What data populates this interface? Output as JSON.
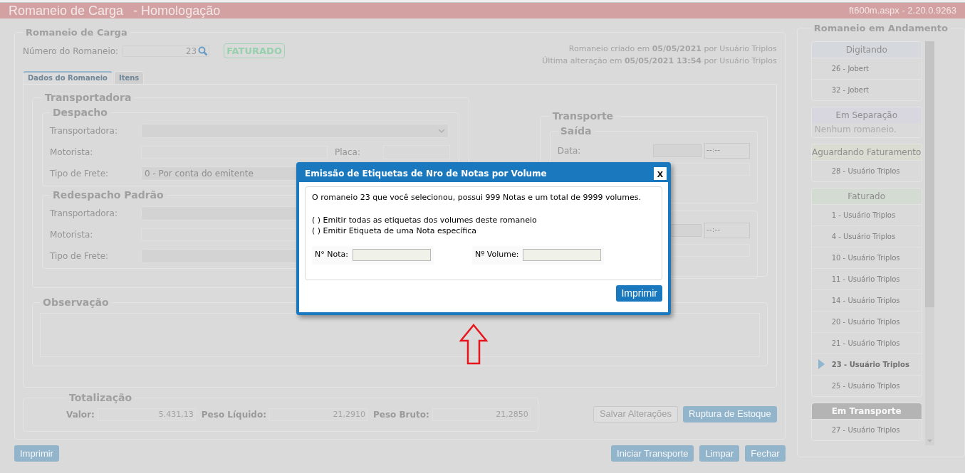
{
  "header": {
    "title": "Romaneio de Carga",
    "environment": "- Homologação",
    "version": "ft600m.aspx - 2.20.0.9263"
  },
  "romaneio": {
    "legend": "Romaneio de Carga",
    "number_label": "Número do Romaneio:",
    "number": "23",
    "status": "FATURADO",
    "created": "Romaneio criado em **05/05/2021** por Usuário Triplos",
    "updated": "Última alteração em **05/05/2021 13:54** por Usuário Triplos"
  },
  "tabs": [
    {
      "label": "Dados do Romaneio",
      "selected": true
    },
    {
      "label": "Itens",
      "selected": false
    }
  ],
  "transportadora": {
    "legend": "Transportadora",
    "sections": [
      {
        "legend": "Despacho",
        "fields": [
          {
            "kind": "select",
            "label": "Transportadora:"
          },
          {
            "kind": "input",
            "label": "Motorista:",
            "extra_label": "Placa:"
          },
          {
            "kind": "select",
            "label": "Tipo de Frete:",
            "value": "0 - Por conta do emitente"
          }
        ]
      },
      {
        "legend": "Redespacho Padrão",
        "fields": [
          {
            "kind": "select",
            "label": "Transportadora:"
          },
          {
            "kind": "input",
            "label": "Motorista:"
          },
          {
            "kind": "select",
            "label": "Tipo de Frete:"
          }
        ]
      }
    ]
  },
  "transporte": {
    "legend": "Transporte",
    "saida": {
      "legend": "Saída",
      "date_label": "Data:",
      "time": "--:--"
    },
    "section_2": {
      "time": "--:--"
    }
  },
  "observacao": {
    "legend": "Observação"
  },
  "form_buttons": [
    {
      "label": "Salvar Alterações",
      "disabled": true
    },
    {
      "label": "Ruptura de Estoque",
      "disabled": false
    }
  ],
  "totalizacao": {
    "legend": "Totalização",
    "items": [
      {
        "label": "Valor:",
        "value": "5.431,13"
      },
      {
        "label": "Peso Líquido:",
        "value": "21,2910"
      },
      {
        "label": "Peso Bruto:",
        "value": "21,2850"
      }
    ]
  },
  "footer": {
    "left_buttons": [
      "Imprimir"
    ],
    "right_buttons": [
      "Iniciar Transporte",
      "Limpar",
      "Fechar"
    ]
  },
  "sidebar": {
    "legend": "Romaneio em Andamento",
    "groups": [
      {
        "title": "Digitando",
        "color": "#d5d9de",
        "items": [
          {
            "label": "26 - Jobert",
            "selected": false
          },
          {
            "label": "32 - Jobert",
            "selected": false
          }
        ]
      },
      {
        "title": "Em Separação",
        "color": "#d8d6df",
        "empty_text": "Nenhum romaneio."
      },
      {
        "title": "Aguardando Faturamento",
        "color": "#dadbd1",
        "items": [
          {
            "label": "28 - Usuário Triplos",
            "selected": false
          }
        ]
      },
      {
        "title": "Faturado",
        "color": "#d3dbd3",
        "items": [
          {
            "label": "1 - Usuário Triplos",
            "selected": false
          },
          {
            "label": "4 - Usuário Triplos",
            "selected": false
          },
          {
            "label": "10 - Usuário Triplos",
            "selected": false
          },
          {
            "label": "11 - Usuário Triplos",
            "selected": false
          },
          {
            "label": "14 - Usuário Triplos",
            "selected": false
          },
          {
            "label": "20 - Usuário Triplos",
            "selected": false
          },
          {
            "label": "21 - Usuário Triplos",
            "selected": false
          },
          {
            "label": "23 - Usuário Triplos",
            "selected": true
          },
          {
            "label": "25 - Usuário Triplos",
            "selected": false
          }
        ]
      },
      {
        "title": "Em Transporte",
        "color": "#b4b4b4",
        "items": [
          {
            "label": "27 - Usuário Triplos",
            "selected": false
          }
        ]
      }
    ]
  },
  "dialog": {
    "title": "Emissão de Etiquetas de Nro de Notas por Volume",
    "close": "x",
    "message": "O romaneio 23 que você selecionou, possui 999 Notas e um total de 9999 volumes.",
    "options": [
      "( ) Emitir todas as etiquetas dos volumes deste romaneio",
      "( ) Emitir Etiqueta de uma Nota específica"
    ],
    "fields": [
      {
        "label": "N° Nota:"
      },
      {
        "label": "Nº Volume:"
      }
    ],
    "button": "Imprimir"
  }
}
